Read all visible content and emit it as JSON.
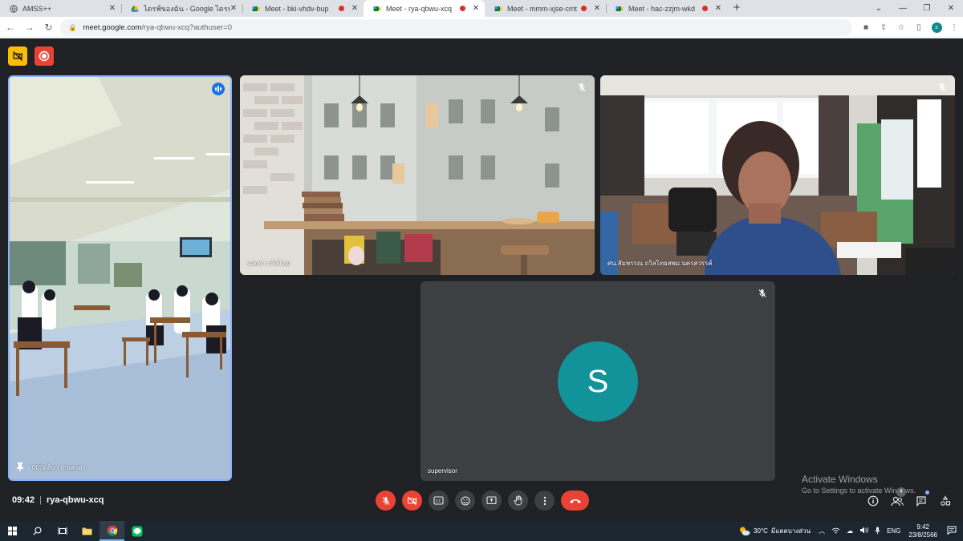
{
  "browser": {
    "tabs": [
      {
        "title": "AMSS++",
        "favicon": "globe-icon",
        "recording": false,
        "active": false
      },
      {
        "title": "ไดรฟ์ของฉัน - Google ไดรฟ์",
        "favicon": "drive-icon",
        "recording": false,
        "active": false
      },
      {
        "title": "Meet - bki-vhdv-bup",
        "favicon": "meet-icon",
        "recording": true,
        "active": false
      },
      {
        "title": "Meet - rya-qbwu-xcq",
        "favicon": "meet-icon",
        "recording": true,
        "active": true
      },
      {
        "title": "Meet - mmm-xjse-cmt",
        "favicon": "meet-icon",
        "recording": true,
        "active": false
      },
      {
        "title": "Meet - hac-zzjm-wkd",
        "favicon": "meet-icon",
        "recording": true,
        "active": false
      }
    ],
    "new_tab_label": "+",
    "url_host": "meet.google.com",
    "url_path": "/rya-qbwu-xcq?authuser=0",
    "profile_initial": "s"
  },
  "meet": {
    "participants": {
      "classroom": {
        "name": "002ดลิษา เกษสงคร"
      },
      "cafe": {
        "name": "เมตตา ถวิลไทย"
      },
      "office": {
        "name": "ศน.สัมพรรณ ถวิลไทยสพม.นครสวรรค์"
      },
      "supervisor": {
        "name": "supervisor",
        "initial": "S"
      }
    },
    "time": "09:42",
    "meeting_code": "rya-qbwu-xcq",
    "people_count": "4"
  },
  "watermark": {
    "line1": "Activate Windows",
    "line2": "Go to Settings to activate Windows."
  },
  "taskbar": {
    "weather_temp": "30°C",
    "weather_desc": "มีแดดบางส่วน",
    "lang": "ENG",
    "clock_time": "9:42",
    "clock_date": "23/8/2566"
  },
  "colors": {
    "meet_bg": "#202124",
    "danger": "#ea4335",
    "accent_blue": "#8ab4f8",
    "avatar_teal": "#12939a"
  }
}
